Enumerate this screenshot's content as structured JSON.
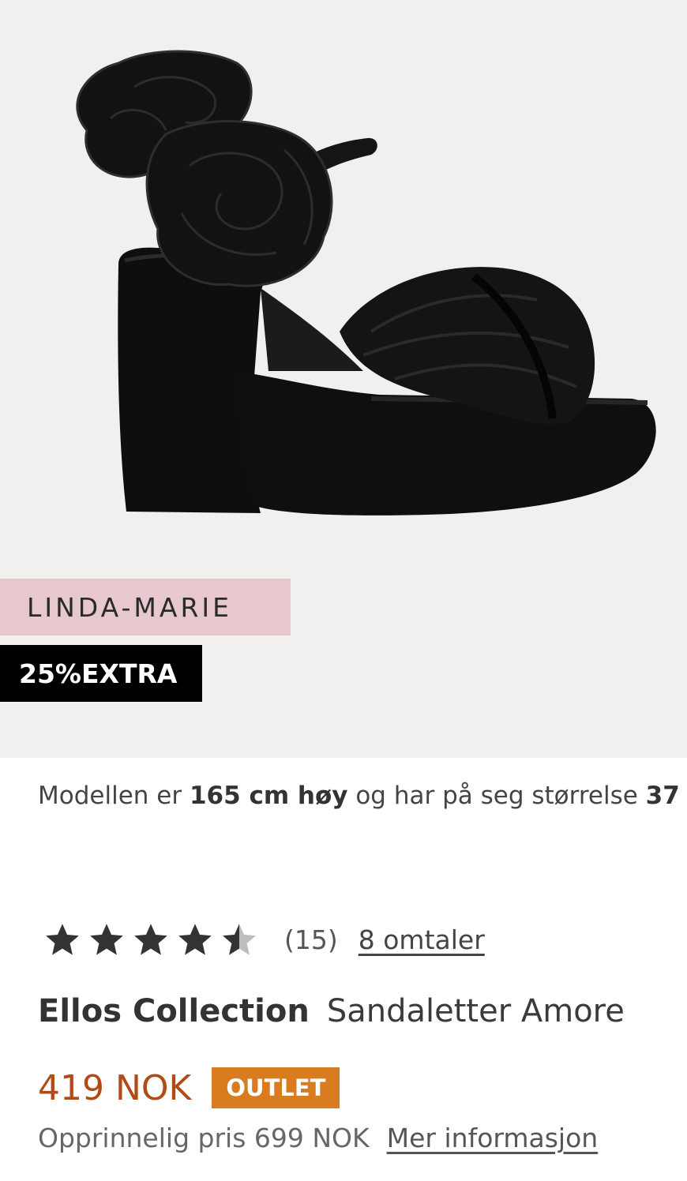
{
  "product": {
    "brand_badge": "LINDA-MARIE",
    "promo_badge": "25%EXTRA",
    "model_info": {
      "prefix": "Modellen er ",
      "height": "165 cm høy",
      "middle": " og har på seg størrelse ",
      "size": "37"
    },
    "rating": {
      "stars": 4.5,
      "count": "(15)",
      "reviews_link": "8 omtaler"
    },
    "brand": "Ellos Collection",
    "name": "Sandaletter Amore",
    "price": "419 NOK",
    "outlet_badge": "OUTLET",
    "original_price": "Opprinnelig pris 699 NOK",
    "more_info_link": "Mer informasjon"
  },
  "colors": {
    "hero_background": "#f1f0ee",
    "brand_badge_bg": "#e8c8cf",
    "price": "#b24a16",
    "outlet": "#d97c1f"
  },
  "icons": [
    "star-icon",
    "half-star-icon"
  ]
}
